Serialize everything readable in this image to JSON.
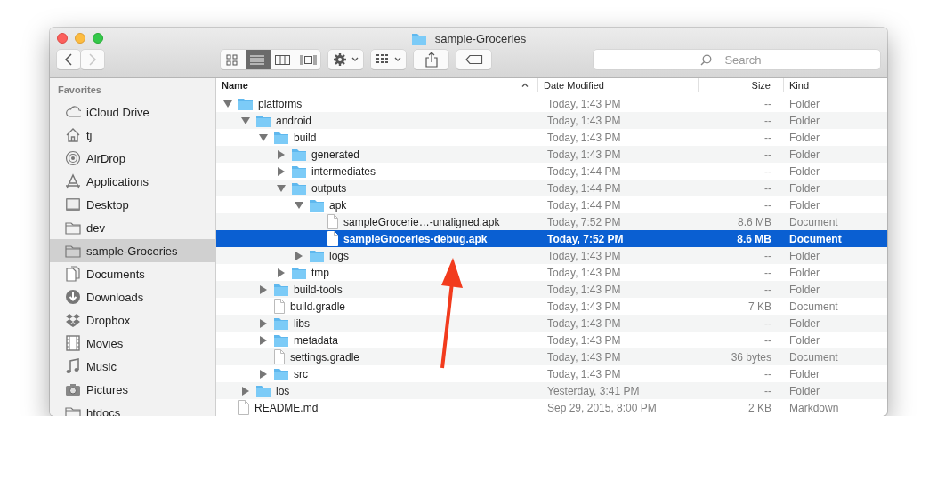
{
  "window": {
    "title": "sample-Groceries"
  },
  "toolbar": {
    "navigation": [
      {
        "kind": "back",
        "disabled": false
      },
      {
        "kind": "forward",
        "disabled": true
      }
    ],
    "views": [
      {
        "kind": "icons",
        "selected": false
      },
      {
        "kind": "list",
        "selected": true
      },
      {
        "kind": "columns",
        "selected": false
      },
      {
        "kind": "coverflow",
        "selected": false
      }
    ],
    "search": {
      "placeholder": "Search"
    }
  },
  "sidebar": {
    "heading": "Favorites",
    "items": [
      {
        "label": "iCloud Drive",
        "kind": "cloud",
        "selected": false
      },
      {
        "label": "tj",
        "kind": "home",
        "selected": false
      },
      {
        "label": "AirDrop",
        "kind": "airdrop",
        "selected": false
      },
      {
        "label": "Applications",
        "kind": "apps",
        "selected": false
      },
      {
        "label": "Desktop",
        "kind": "desktop",
        "selected": false
      },
      {
        "label": "dev",
        "kind": "folder",
        "selected": false
      },
      {
        "label": "sample-Groceries",
        "kind": "folder",
        "selected": true
      },
      {
        "label": "Documents",
        "kind": "documents",
        "selected": false
      },
      {
        "label": "Downloads",
        "kind": "downloads",
        "selected": false
      },
      {
        "label": "Dropbox",
        "kind": "dropbox",
        "selected": false
      },
      {
        "label": "Movies",
        "kind": "movies",
        "selected": false
      },
      {
        "label": "Music",
        "kind": "music",
        "selected": false
      },
      {
        "label": "Pictures",
        "kind": "pictures",
        "selected": false
      },
      {
        "label": "htdocs",
        "kind": "folder",
        "selected": false
      }
    ]
  },
  "table": {
    "columns": [
      {
        "label": "Name",
        "sorted": true
      },
      {
        "label": "Date Modified",
        "sorted": false
      },
      {
        "label": "Size",
        "sorted": false
      },
      {
        "label": "Kind",
        "sorted": false
      }
    ],
    "rows": [
      {
        "name": "platforms",
        "kind": "folder",
        "expanded": true,
        "date": "Today, 1:43 PM",
        "size": "--",
        "kind_label": "Folder",
        "selected": false,
        "children": [
          {
            "name": "android",
            "kind": "folder",
            "expanded": true,
            "date": "Today, 1:43 PM",
            "size": "--",
            "kind_label": "Folder",
            "selected": false,
            "children": [
              {
                "name": "build",
                "kind": "folder",
                "expanded": true,
                "date": "Today, 1:43 PM",
                "size": "--",
                "kind_label": "Folder",
                "selected": false,
                "children": [
                  {
                    "name": "generated",
                    "kind": "folder",
                    "expanded": false,
                    "date": "Today, 1:43 PM",
                    "size": "--",
                    "kind_label": "Folder",
                    "selected": false
                  },
                  {
                    "name": "intermediates",
                    "kind": "folder",
                    "expanded": false,
                    "date": "Today, 1:44 PM",
                    "size": "--",
                    "kind_label": "Folder",
                    "selected": false
                  },
                  {
                    "name": "outputs",
                    "kind": "folder",
                    "expanded": true,
                    "date": "Today, 1:44 PM",
                    "size": "--",
                    "kind_label": "Folder",
                    "selected": false,
                    "children": [
                      {
                        "name": "apk",
                        "kind": "folder",
                        "expanded": true,
                        "date": "Today, 1:44 PM",
                        "size": "--",
                        "kind_label": "Folder",
                        "selected": false,
                        "children": [
                          {
                            "name": "sampleGrocerie…-unaligned.apk",
                            "kind": "file",
                            "date": "Today, 7:52 PM",
                            "size": "8.6 MB",
                            "kind_label": "Document",
                            "selected": false
                          },
                          {
                            "name": "sampleGroceries-debug.apk",
                            "kind": "file",
                            "date": "Today, 7:52 PM",
                            "size": "8.6 MB",
                            "kind_label": "Document",
                            "selected": true
                          }
                        ]
                      },
                      {
                        "name": "logs",
                        "kind": "folder",
                        "expanded": false,
                        "date": "Today, 1:43 PM",
                        "size": "--",
                        "kind_label": "Folder",
                        "selected": false
                      }
                    ]
                  },
                  {
                    "name": "tmp",
                    "kind": "folder",
                    "expanded": false,
                    "date": "Today, 1:43 PM",
                    "size": "--",
                    "kind_label": "Folder",
                    "selected": false
                  }
                ]
              },
              {
                "name": "build-tools",
                "kind": "folder",
                "expanded": false,
                "date": "Today, 1:43 PM",
                "size": "--",
                "kind_label": "Folder",
                "selected": false
              },
              {
                "name": "build.gradle",
                "kind": "file",
                "date": "Today, 1:43 PM",
                "size": "7 KB",
                "kind_label": "Document",
                "selected": false
              },
              {
                "name": "libs",
                "kind": "folder",
                "expanded": false,
                "date": "Today, 1:43 PM",
                "size": "--",
                "kind_label": "Folder",
                "selected": false
              },
              {
                "name": "metadata",
                "kind": "folder",
                "expanded": false,
                "date": "Today, 1:43 PM",
                "size": "--",
                "kind_label": "Folder",
                "selected": false
              },
              {
                "name": "settings.gradle",
                "kind": "file",
                "date": "Today, 1:43 PM",
                "size": "36 bytes",
                "kind_label": "Document",
                "selected": false
              },
              {
                "name": "src",
                "kind": "folder",
                "expanded": false,
                "date": "Today, 1:43 PM",
                "size": "--",
                "kind_label": "Folder",
                "selected": false
              }
            ]
          },
          {
            "name": "ios",
            "kind": "folder",
            "expanded": false,
            "date": "Yesterday, 3:41 PM",
            "size": "--",
            "kind_label": "Folder",
            "selected": false
          }
        ]
      },
      {
        "name": "README.md",
        "kind": "file",
        "date": "Sep 29, 2015, 8:00 PM",
        "size": "2 KB",
        "kind_label": "Markdown",
        "selected": false
      }
    ]
  }
}
